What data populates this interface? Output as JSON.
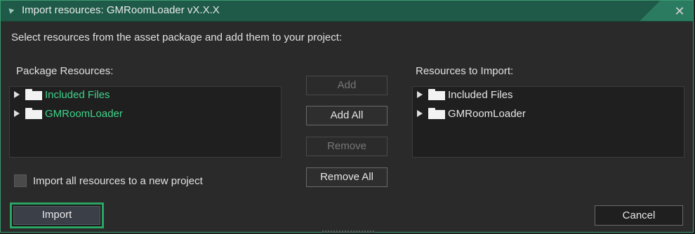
{
  "window": {
    "title": "Import resources: GMRoomLoader vX.X.X",
    "close_glyph": "✕"
  },
  "instruction": "Select resources from the asset package and add them to your project:",
  "left_panel": {
    "label": "Package Resources:",
    "items": [
      {
        "label": "Included Files",
        "icon": "folder-icon",
        "color": "#3fd38a"
      },
      {
        "label": "GMRoomLoader",
        "icon": "folder-icon",
        "color": "#3fd38a"
      }
    ]
  },
  "right_panel": {
    "label": "Resources to Import:",
    "items": [
      {
        "label": "Included Files",
        "icon": "folder-icon"
      },
      {
        "label": "GMRoomLoader",
        "icon": "folder-icon"
      }
    ]
  },
  "buttons": {
    "add": "Add",
    "add_all": "Add All",
    "remove": "Remove",
    "remove_all": "Remove All",
    "import": "Import",
    "cancel": "Cancel"
  },
  "checkbox": {
    "label": "Import all resources to a new project",
    "checked": false
  },
  "colors": {
    "accent": "#2aa565",
    "titlebar": "#1e5a47",
    "green_text": "#3fd38a"
  }
}
